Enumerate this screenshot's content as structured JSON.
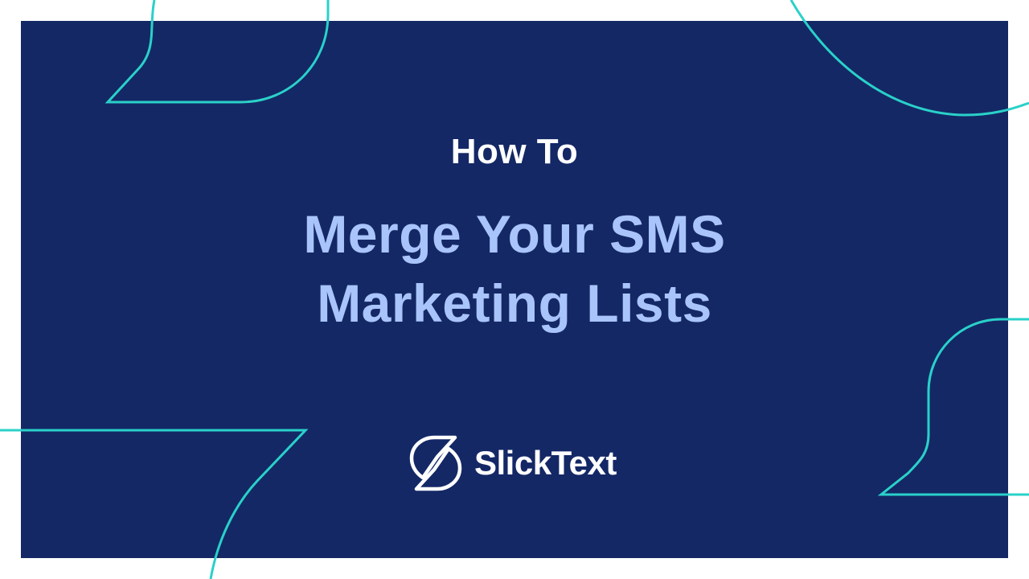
{
  "slide": {
    "eyebrow": "How To",
    "headline_line1": "Merge Your SMS",
    "headline_line2": "Marketing Lists"
  },
  "brand": {
    "name": "SlickText",
    "logo_icon": "slicktext-logo-icon"
  },
  "colors": {
    "background_frame": "#ffffff",
    "panel": "#142866",
    "accent_line": "#2ad1c9",
    "eyebrow_text": "#ffffff",
    "headline_text": "#a9c4fb",
    "brand_text": "#ffffff"
  }
}
